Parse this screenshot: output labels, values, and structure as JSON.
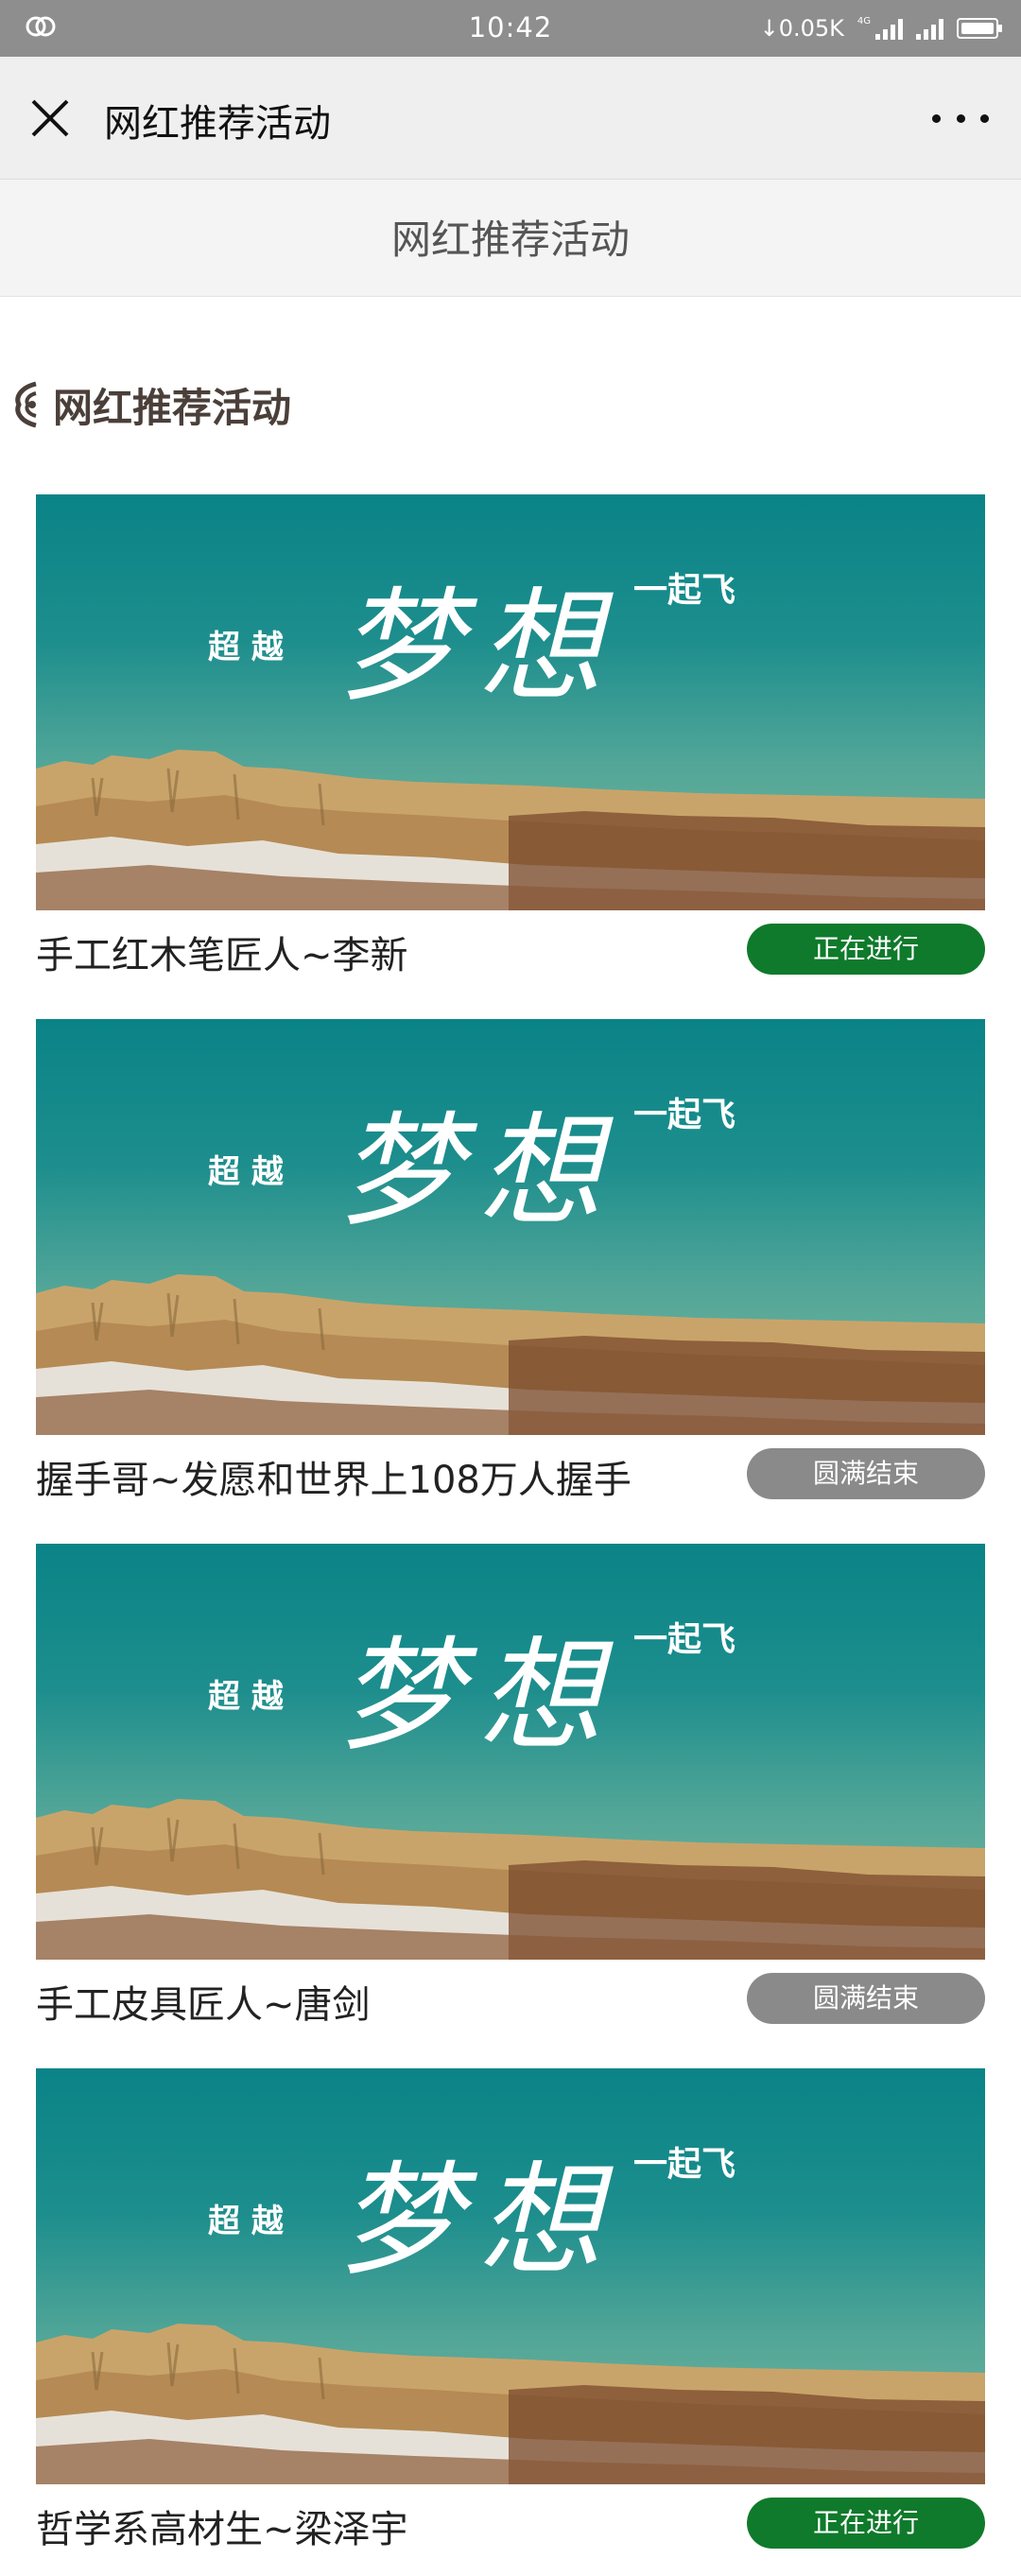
{
  "status_bar": {
    "time": "10:42",
    "net_speed": "↓0.05K",
    "network": "4G",
    "colors": {
      "bg": "#8e8e8e"
    }
  },
  "nav_bar": {
    "title": "网红推荐活动",
    "close_icon": "close-icon",
    "more_icon": "more-dots-icon"
  },
  "page_header": {
    "title": "网红推荐活动"
  },
  "section": {
    "title": "网红推荐活动",
    "icon": "ornament-icon"
  },
  "banner": {
    "left_text": "超 越",
    "main_text": "梦想",
    "right_text": "一起飞"
  },
  "activities": [
    {
      "title": "手工红木笔匠人~李新",
      "status": "正在进行",
      "state": "active"
    },
    {
      "title": "握手哥~发愿和世界上108万人握手",
      "status": "圆满结束",
      "state": "ended"
    },
    {
      "title": "手工皮具匠人~唐剑",
      "status": "圆满结束",
      "state": "ended"
    },
    {
      "title": "哲学系高材生~梁泽宇",
      "status": "正在进行",
      "state": "active"
    }
  ],
  "colors": {
    "active": "#0f7a2b",
    "ended": "#8a8a8a",
    "banner_top": "#0a8387",
    "banner_bottom": "#7fb99c"
  }
}
